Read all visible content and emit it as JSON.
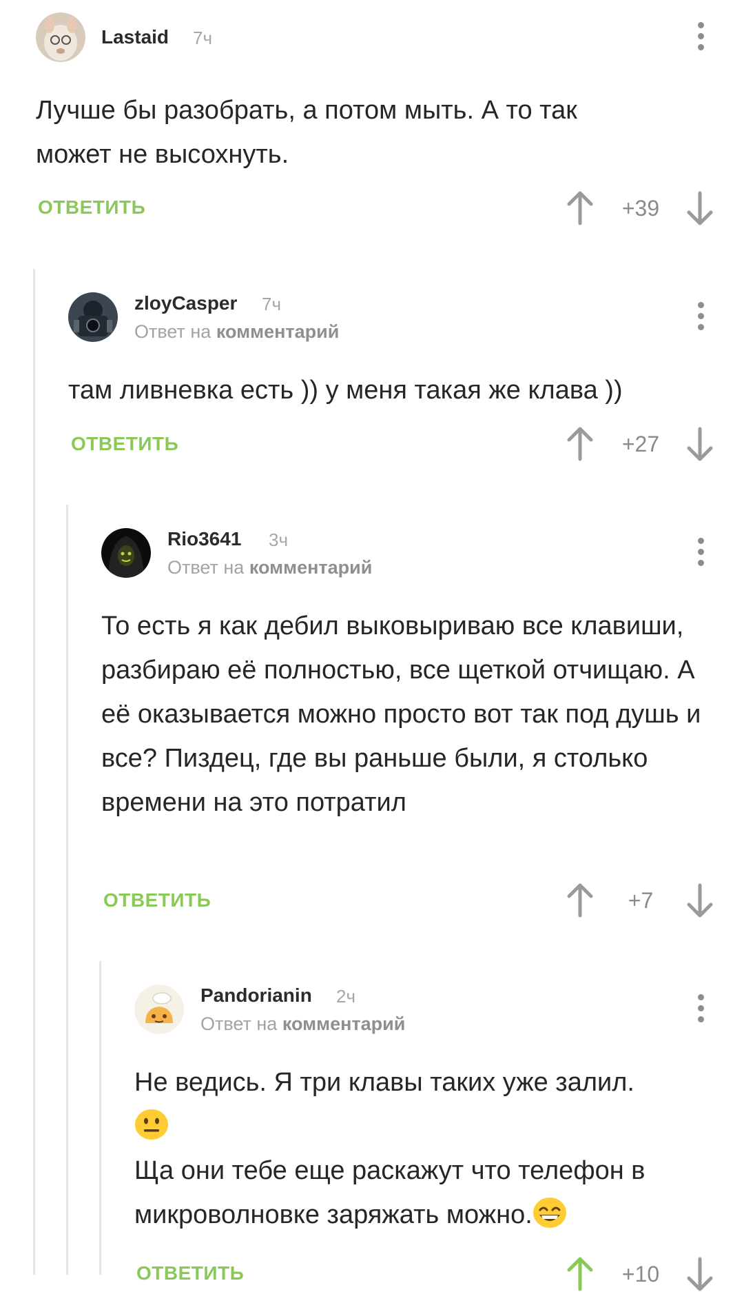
{
  "labels": {
    "reply_prefix": "Ответ на",
    "reply_target": "комментарий",
    "reply_button": "ОТВЕТИТЬ"
  },
  "colors": {
    "accent_green": "#8ac858",
    "thread_line": "#e6e6e6",
    "emoji_yellow": "#ffcc33"
  },
  "comments": [
    {
      "username": "Lastaid",
      "time": "7ч",
      "text": "Лучше бы разобрать, а потом мыть. А то так может не высохнуть.",
      "score": "+39",
      "avatar_icon": "dog-avatar"
    },
    {
      "username": "zloyCasper",
      "time": "7ч",
      "text": "там ливневка есть )) у меня такая же клава ))",
      "score": "+27",
      "avatar_icon": "photographer-avatar"
    },
    {
      "username": "Rio3641",
      "time": "3ч",
      "text": "То есть я как дебил выковыриваю все клавиши, разбираю её полностью, все щеткой отчищаю. А её оказывается можно просто вот так под душь и все? Пиздец, где вы раньше были, я столько времени на это потратил",
      "score": "+7",
      "avatar_icon": "hooded-figure-avatar"
    },
    {
      "username": "Pandorianin",
      "time": "2ч",
      "text_line1": "Не ведись. Я три клавы таких уже залил.",
      "text_line2": "Ща они тебе еще раскажут что телефон в микроволновке заряжать можно.",
      "score": "+10",
      "avatar_icon": "cartoon-chef-avatar",
      "emojis": [
        "neutral-face-emoji",
        "grinning-face-emoji"
      ]
    }
  ]
}
